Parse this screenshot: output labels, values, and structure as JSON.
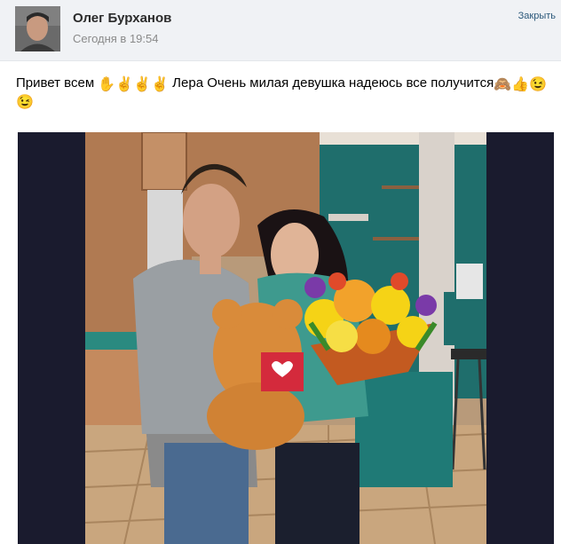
{
  "post": {
    "author": "Олег Бурханов",
    "timestamp": "Сегодня в 19:54",
    "close_label": "Закрыть",
    "text_main": "Привет всем",
    "text_after_hands": "Лера Очень милая девушка надеюсь все получится",
    "emoji": {
      "hand": "✋",
      "victory": "✌",
      "monkey": "🙈",
      "thumbs": "👍",
      "wink": "😉"
    }
  },
  "colors": {
    "header_bg": "#f0f2f5",
    "link": "#2b587a",
    "photo_frame": "#1a1b2e",
    "wall_teal": "#1f6e6c",
    "flowers_yellow": "#f5d316",
    "teddy_orange": "#d98b3a"
  }
}
